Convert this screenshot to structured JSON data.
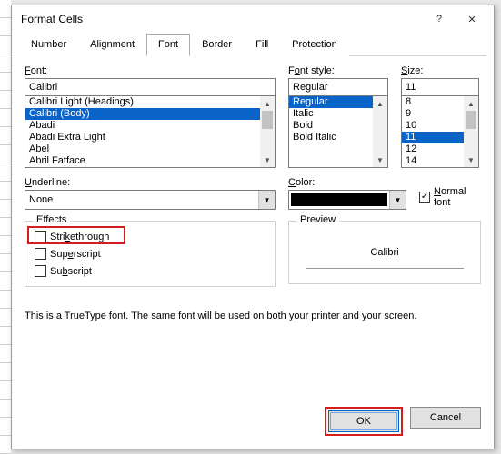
{
  "window": {
    "title": "Format Cells",
    "help": "?",
    "close": "✕"
  },
  "tabs": [
    "Number",
    "Alignment",
    "Font",
    "Border",
    "Fill",
    "Protection"
  ],
  "active_tab": "Font",
  "font": {
    "label": "Font:",
    "value": "Calibri",
    "items": [
      "Calibri Light (Headings)",
      "Calibri (Body)",
      "Abadi",
      "Abadi Extra Light",
      "Abel",
      "Abril Fatface"
    ],
    "selected": "Calibri (Body)"
  },
  "font_style": {
    "label": "Font style:",
    "value": "Regular",
    "items": [
      "Regular",
      "Italic",
      "Bold",
      "Bold Italic"
    ],
    "selected": "Regular"
  },
  "size": {
    "label": "Size:",
    "value": "11",
    "items": [
      "8",
      "9",
      "10",
      "11",
      "12",
      "14"
    ],
    "selected": "11"
  },
  "underline": {
    "label": "Underline:",
    "value": "None"
  },
  "color": {
    "label": "Color:",
    "value": "#000000"
  },
  "normal_font": {
    "label": "Normal font",
    "checked": true
  },
  "effects": {
    "legend": "Effects",
    "strikethrough": {
      "label": "Strikethrough",
      "checked": false
    },
    "superscript": {
      "label": "Superscript",
      "checked": false
    },
    "subscript": {
      "label": "Subscript",
      "checked": false
    }
  },
  "preview": {
    "legend": "Preview",
    "sample": "Calibri"
  },
  "info": "This is a TrueType font.  The same font will be used on both your printer and your screen.",
  "buttons": {
    "ok": "OK",
    "cancel": "Cancel"
  }
}
